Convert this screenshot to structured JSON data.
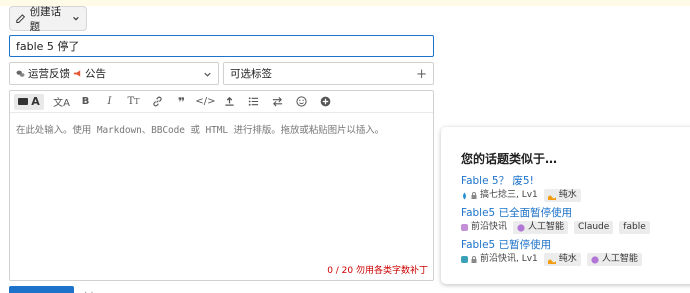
{
  "composer": {
    "create_label": "创建话题"
  },
  "title_input": {
    "value": "fable 5 停了"
  },
  "category": {
    "label1": "运营反馈",
    "label2": "公告"
  },
  "tags": {
    "placeholder": "可选标签"
  },
  "editor": {
    "placeholder": "在此处输入。使用 Markdown、BBCode 或 HTML 进行排版。拖放或粘贴图片以插入。",
    "char_hint": "0 / 20 勿用各类字数补丁"
  },
  "similar": {
    "heading": "您的话题类似于…",
    "items": [
      {
        "title": "Fable 5？ 废5!",
        "author": "搞七捻三, Lv1",
        "tags": [
          "纯水"
        ]
      },
      {
        "title": "Fable5 已全面暂停使用",
        "author": "前沿快讯",
        "tags": [
          "人工智能",
          "Claude",
          "fable"
        ]
      },
      {
        "title": "Fable5 已暂停使用",
        "author": "前沿快讯, Lv1",
        "tags": [
          "纯水",
          "人工智能"
        ]
      }
    ]
  },
  "colors": {
    "accent": "#1d73c9",
    "warning": "#cc0000"
  }
}
